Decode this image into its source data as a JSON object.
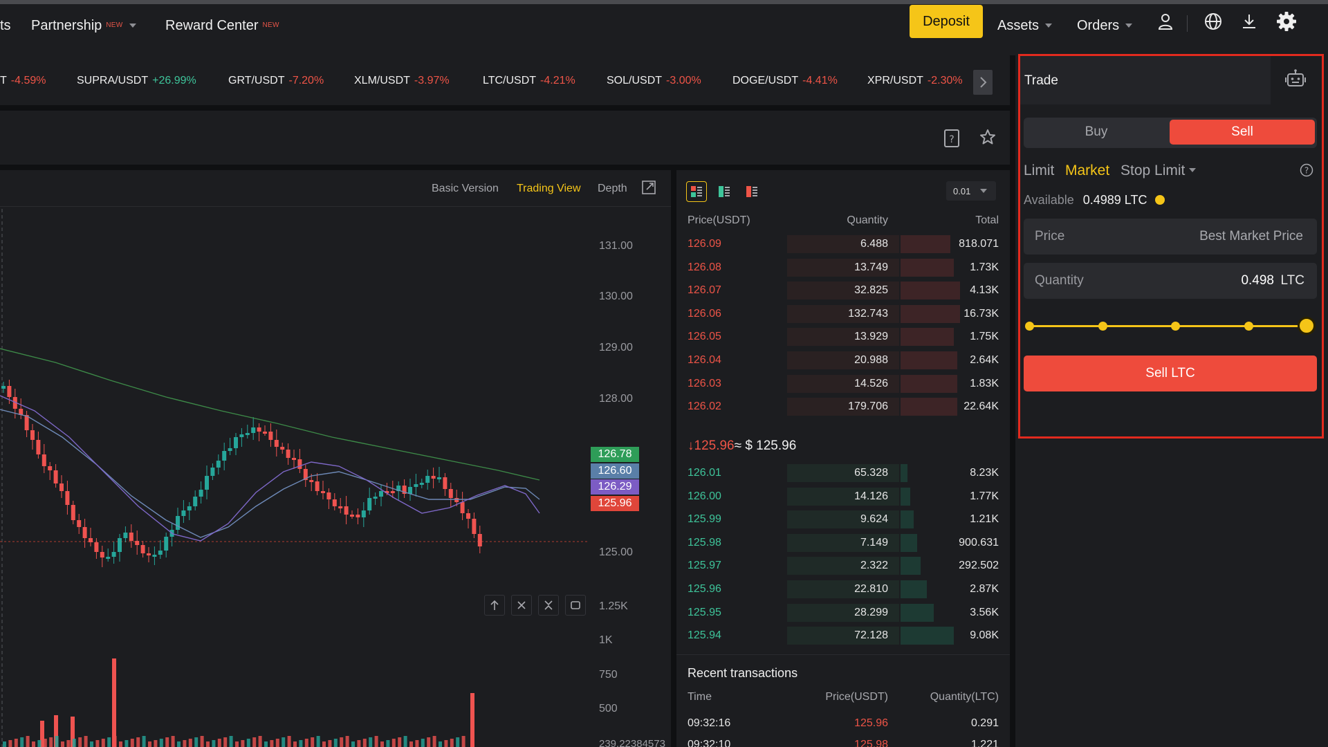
{
  "header": {
    "cut_item": "ts",
    "partnership": {
      "label": "Partnership",
      "badge": "NEW"
    },
    "reward_center": {
      "label": "Reward Center",
      "badge": "NEW"
    },
    "deposit_label": "Deposit",
    "assets_label": "Assets",
    "orders_label": "Orders",
    "icons": [
      "user-icon",
      "globe-icon",
      "download-icon",
      "gear-icon"
    ]
  },
  "tickers": [
    {
      "pair": "T",
      "change": "-4.59%",
      "dir": "neg"
    },
    {
      "pair": "SUPRA/USDT",
      "change": "+26.99%",
      "dir": "pos"
    },
    {
      "pair": "GRT/USDT",
      "change": "-7.20%",
      "dir": "neg"
    },
    {
      "pair": "XLM/USDT",
      "change": "-3.97%",
      "dir": "neg"
    },
    {
      "pair": "LTC/USDT",
      "change": "-4.21%",
      "dir": "neg"
    },
    {
      "pair": "SOL/USDT",
      "change": "-3.00%",
      "dir": "neg"
    },
    {
      "pair": "DOGE/USDT",
      "change": "-4.41%",
      "dir": "neg"
    },
    {
      "pair": "XPR/USDT",
      "change": "-2.30%",
      "dir": "neg"
    }
  ],
  "chart": {
    "tabs": {
      "basic": "Basic Version",
      "trading": "Trading View",
      "depth": "Depth"
    },
    "price_axis": [
      "131.00",
      "130.00",
      "129.00",
      "128.00",
      "125.00"
    ],
    "price_tags": [
      {
        "value": "126.78",
        "color": "#2e9d58"
      },
      {
        "value": "126.60",
        "color": "#5a7fa8"
      },
      {
        "value": "126.29",
        "color": "#7c5cc4"
      },
      {
        "value": "125.96",
        "color": "#e0463a"
      }
    ],
    "volume_axis": [
      "1.25K",
      "1K",
      "750",
      "500"
    ],
    "volume_readout": "239.22384573",
    "colors": {
      "up": "#26a69a",
      "down": "#ef5350",
      "ma_green": "#3d8a48",
      "ma_blue": "#6e8ab8",
      "ma_purple": "#7e68c8"
    }
  },
  "orderbook": {
    "precision": "0.01",
    "headers": {
      "price": "Price(USDT)",
      "qty": "Quantity",
      "total": "Total"
    },
    "asks": [
      {
        "price": "126.09",
        "qty": "6.488",
        "total": "818.071",
        "depth": 0.05,
        "cum": 0.15
      },
      {
        "price": "126.08",
        "qty": "13.749",
        "total": "1.73K",
        "depth": 0.41,
        "cum": 0.16
      },
      {
        "price": "126.07",
        "qty": "32.825",
        "total": "4.13K",
        "depth": 0.41,
        "cum": 0.18
      },
      {
        "price": "126.06",
        "qty": "132.743",
        "total": "16.73K",
        "depth": 0.41,
        "cum": 0.18
      },
      {
        "price": "126.05",
        "qty": "13.929",
        "total": "1.75K",
        "depth": 0.41,
        "cum": 0.16
      },
      {
        "price": "126.04",
        "qty": "20.988",
        "total": "2.64K",
        "depth": 0.41,
        "cum": 0.17
      },
      {
        "price": "126.03",
        "qty": "14.526",
        "total": "1.83K",
        "depth": 0.41,
        "cum": 0.17
      },
      {
        "price": "126.02",
        "qty": "179.706",
        "total": "22.64K",
        "depth": 0.41,
        "cum": 0.17
      }
    ],
    "mid": {
      "price": "125.96",
      "usd": "≈ $ 125.96",
      "arrow": "↓"
    },
    "bids": [
      {
        "price": "126.01",
        "qty": "65.328",
        "total": "8.23K",
        "depth": 0.41,
        "cum": 0.02
      },
      {
        "price": "126.00",
        "qty": "14.126",
        "total": "1.77K",
        "depth": 0.41,
        "cum": 0.03
      },
      {
        "price": "125.99",
        "qty": "9.624",
        "total": "1.21K",
        "depth": 0.41,
        "cum": 0.04
      },
      {
        "price": "125.98",
        "qty": "7.149",
        "total": "900.631",
        "depth": 0.41,
        "cum": 0.05
      },
      {
        "price": "125.97",
        "qty": "2.322",
        "total": "292.502",
        "depth": 0.41,
        "cum": 0.06
      },
      {
        "price": "125.96",
        "qty": "22.810",
        "total": "2.87K",
        "depth": 0.41,
        "cum": 0.08
      },
      {
        "price": "125.95",
        "qty": "28.299",
        "total": "3.56K",
        "depth": 0.41,
        "cum": 0.1
      },
      {
        "price": "125.94",
        "qty": "72.128",
        "total": "9.08K",
        "depth": 0.41,
        "cum": 0.16
      }
    ]
  },
  "recent": {
    "title": "Recent transactions",
    "headers": {
      "time": "Time",
      "price": "Price(USDT)",
      "qty": "Quantity(LTC)"
    },
    "rows": [
      {
        "time": "09:32:16",
        "price": "125.96",
        "qty": "0.291"
      },
      {
        "time": "09:32:10",
        "price": "125.98",
        "qty": "1.221"
      }
    ]
  },
  "trade": {
    "title": "Trade",
    "buy_label": "Buy",
    "sell_label": "Sell",
    "order_types": {
      "limit": "Limit",
      "market": "Market",
      "stop_limit": "Stop Limit"
    },
    "available_label": "Available",
    "available_value": "0.4989 LTC",
    "price_label": "Price",
    "price_value": "Best Market Price",
    "quantity_label": "Quantity",
    "quantity_value": "0.498",
    "quantity_unit": "LTC",
    "slider_percent": 100,
    "submit_label": "Sell LTC",
    "colors": {
      "sell": "#ee4b3c",
      "accent": "#f5c518"
    }
  }
}
